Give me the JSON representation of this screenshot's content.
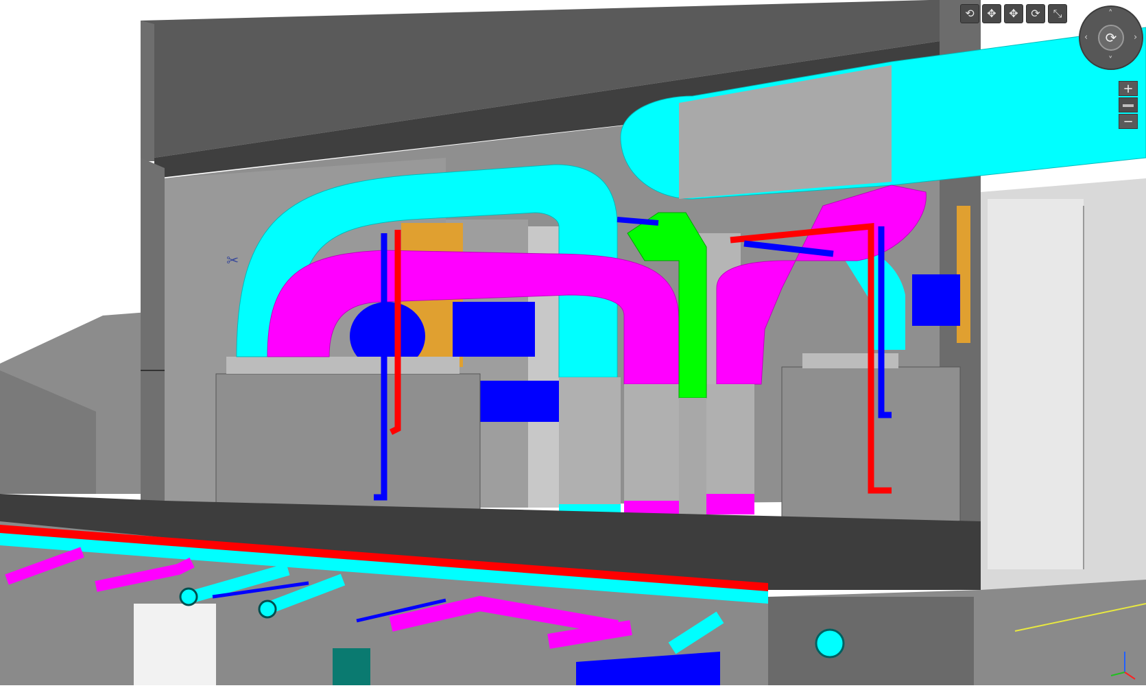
{
  "toolbar": {
    "buttons": [
      {
        "icon": "orbit-icon",
        "glyph": "⟲"
      },
      {
        "icon": "pan-icon",
        "glyph": "✥"
      },
      {
        "icon": "move-icon",
        "glyph": "✥"
      },
      {
        "icon": "look-around-icon",
        "glyph": "⟳"
      },
      {
        "icon": "fit-view-icon",
        "glyph": "⤡"
      }
    ]
  },
  "navigation": {
    "wheel_center_glyph": "⟳",
    "arrows": {
      "up": "˄",
      "down": "˅",
      "left": "‹",
      "right": "›"
    },
    "zoom_in": "+",
    "zoom_out": "−"
  },
  "cursor_glyph": "✂",
  "colors": {
    "supply_duct": "#00ffff",
    "return_duct": "#ff00ff",
    "hot_pipe": "#ff0000",
    "cold_pipe": "#0000ff",
    "green_duct": "#00ff00",
    "orange_element": "#e0a030",
    "concrete": "#8a8a8a",
    "slab_dark": "#444444"
  }
}
